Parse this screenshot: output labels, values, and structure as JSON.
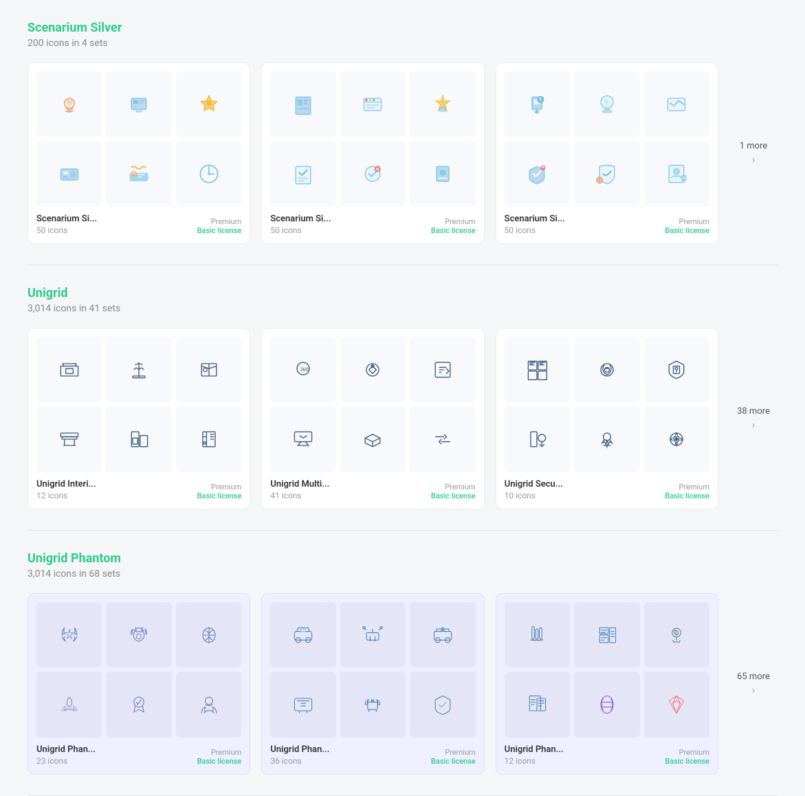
{
  "sections": [
    {
      "id": "scenarium-silver",
      "title": "Scenarium Silver",
      "subtitle": "200 icons in 4 sets",
      "title_color": "#2ecc8a",
      "more_label": "1 more",
      "sets": [
        {
          "name": "Scenarium Si...",
          "count": "50 icons",
          "license": "Basic license",
          "tier": "Premium",
          "style": "silver"
        },
        {
          "name": "Scenarium Si...",
          "count": "50 icons",
          "license": "Basic license",
          "tier": "Premium",
          "style": "silver"
        },
        {
          "name": "Scenarium Si...",
          "count": "50 icons",
          "license": "Basic license",
          "tier": "Premium",
          "style": "silver"
        }
      ]
    },
    {
      "id": "unigrid",
      "title": "Unigrid",
      "subtitle": "3,014 icons in 41 sets",
      "title_color": "#2ecc8a",
      "more_label": "38 more",
      "sets": [
        {
          "name": "Unigrid Interi...",
          "count": "12 icons",
          "license": "Basic license",
          "tier": "Premium",
          "style": "outline"
        },
        {
          "name": "Unigrid Multi...",
          "count": "41 icons",
          "license": "Basic license",
          "tier": "Premium",
          "style": "outline"
        },
        {
          "name": "Unigrid Secu...",
          "count": "10 icons",
          "license": "Basic license",
          "tier": "Premium",
          "style": "outline"
        }
      ]
    },
    {
      "id": "unigrid-phantom",
      "title": "Unigrid Phantom",
      "subtitle": "3,014 icons in 68 sets",
      "title_color": "#2ecc8a",
      "more_label": "65 more",
      "sets": [
        {
          "name": "Unigrid Phan...",
          "count": "23 icons",
          "license": "Basic license",
          "tier": "Premium",
          "style": "phantom"
        },
        {
          "name": "Unigrid Phan...",
          "count": "36 icons",
          "license": "Basic license",
          "tier": "Premium",
          "style": "phantom"
        },
        {
          "name": "Unigrid Phan...",
          "count": "12 icons",
          "license": "Basic license",
          "tier": "Premium",
          "style": "phantom"
        }
      ]
    }
  ],
  "labels": {
    "premium": "Premium",
    "basic_license": "Basic license"
  }
}
